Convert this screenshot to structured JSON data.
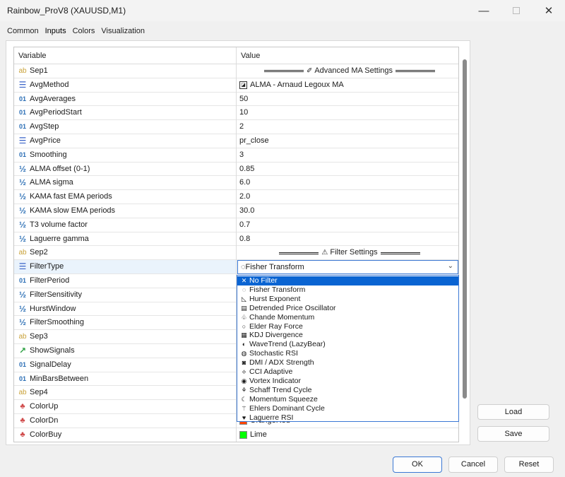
{
  "window": {
    "title": "Rainbow_ProV8 (XAUUSD,M1)"
  },
  "tabs": [
    "Common",
    "Inputs",
    "Colors",
    "Visualization"
  ],
  "grid": {
    "headers": {
      "variable": "Variable",
      "value": "Value"
    },
    "rows": [
      {
        "icon": "ab",
        "name": "Sep1",
        "type": "sep",
        "value": "Advanced MA Settings",
        "glyph": "✐"
      },
      {
        "icon": "enum",
        "name": "AvgMethod",
        "type": "enum",
        "value": "ALMA  - Arnaud Legoux MA"
      },
      {
        "icon": "01",
        "name": "AvgAverages",
        "type": "text",
        "value": "50"
      },
      {
        "icon": "01",
        "name": "AvgPeriodStart",
        "type": "text",
        "value": "10"
      },
      {
        "icon": "01",
        "name": "AvgStep",
        "type": "text",
        "value": "2"
      },
      {
        "icon": "enum",
        "name": "AvgPrice",
        "type": "text",
        "value": "pr_close"
      },
      {
        "icon": "01",
        "name": "Smoothing",
        "type": "text",
        "value": "3"
      },
      {
        "icon": "half",
        "name": "ALMA offset (0-1)",
        "type": "text",
        "value": "0.85"
      },
      {
        "icon": "half",
        "name": "ALMA sigma",
        "type": "text",
        "value": "6.0"
      },
      {
        "icon": "half",
        "name": "KAMA fast EMA periods",
        "type": "text",
        "value": "2.0"
      },
      {
        "icon": "half",
        "name": "KAMA slow EMA periods",
        "type": "text",
        "value": "30.0"
      },
      {
        "icon": "half",
        "name": "T3 volume factor",
        "type": "text",
        "value": "0.7"
      },
      {
        "icon": "half",
        "name": "Laguerre gamma",
        "type": "text",
        "value": "0.8"
      },
      {
        "icon": "ab",
        "name": "Sep2",
        "type": "sep",
        "value": "Filter Settings",
        "glyph": "⚠"
      },
      {
        "icon": "enum",
        "name": "FilterType",
        "type": "combo",
        "value": "Fisher Transform"
      },
      {
        "icon": "01",
        "name": "FilterPeriod",
        "type": "text",
        "value": ""
      },
      {
        "icon": "half",
        "name": "FilterSensitivity",
        "type": "text",
        "value": ""
      },
      {
        "icon": "half",
        "name": "HurstWindow",
        "type": "text",
        "value": ""
      },
      {
        "icon": "half",
        "name": "FilterSmoothing",
        "type": "text",
        "value": ""
      },
      {
        "icon": "ab",
        "name": "Sep3",
        "type": "text",
        "value": ""
      },
      {
        "icon": "bool",
        "name": "ShowSignals",
        "type": "text",
        "value": ""
      },
      {
        "icon": "01",
        "name": "SignalDelay",
        "type": "text",
        "value": ""
      },
      {
        "icon": "01",
        "name": "MinBarsBetween",
        "type": "text",
        "value": ""
      },
      {
        "icon": "ab",
        "name": "Sep4",
        "type": "text",
        "value": ""
      },
      {
        "icon": "color",
        "name": "ColorUp",
        "type": "text",
        "value": ""
      },
      {
        "icon": "color",
        "name": "ColorDn",
        "type": "color",
        "value": "OrangeRed",
        "color": "#ff4500"
      },
      {
        "icon": "color",
        "name": "ColorBuy",
        "type": "color",
        "value": "Lime",
        "color": "#00ff00"
      }
    ]
  },
  "dropdown": {
    "options": [
      {
        "glyph": "✕",
        "label": "No Filter",
        "highlighted": true
      },
      {
        "glyph": "◌",
        "label": "Fisher Transform"
      },
      {
        "glyph": "◺",
        "label": "Hurst Exponent"
      },
      {
        "glyph": "▤",
        "label": "Detrended Price Oscillator"
      },
      {
        "glyph": "♧",
        "label": "Chande Momentum"
      },
      {
        "glyph": "○",
        "label": "Elder Ray Force"
      },
      {
        "glyph": "▦",
        "label": "KDJ Divergence"
      },
      {
        "glyph": "◐",
        "label": "WaveTrend (LazyBear)"
      },
      {
        "glyph": "◍",
        "label": "Stochastic RSI"
      },
      {
        "glyph": "◙",
        "label": "DMI / ADX Strength"
      },
      {
        "glyph": "⟡",
        "label": "CCI Adaptive"
      },
      {
        "glyph": "◉",
        "label": "Vortex Indicator"
      },
      {
        "glyph": "⚘",
        "label": "Schaff Trend Cycle"
      },
      {
        "glyph": "☾",
        "label": "Momentum Squeeze"
      },
      {
        "glyph": "⚚",
        "label": "Ehlers Dominant Cycle"
      },
      {
        "glyph": "♥",
        "label": "Laguerre RSI"
      }
    ]
  },
  "buttons": {
    "load": "Load",
    "save": "Save",
    "ok": "OK",
    "cancel": "Cancel",
    "reset": "Reset"
  },
  "icons": {
    "minimize": "—",
    "close": "✕",
    "chevron": "⌄"
  }
}
